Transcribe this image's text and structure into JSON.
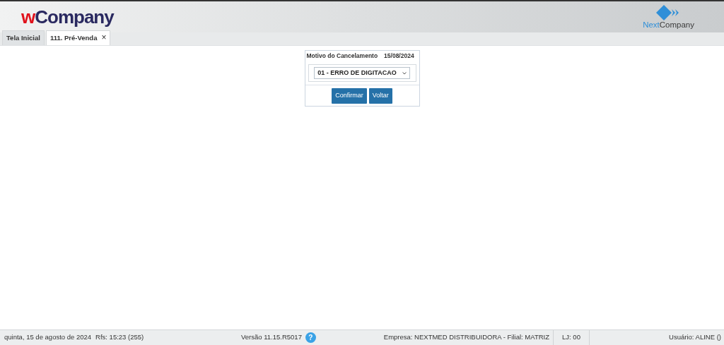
{
  "header": {
    "logo": [
      {
        "text": "w",
        "color": "#e0121c"
      },
      {
        "text": "Company",
        "color": "#2a2960"
      }
    ],
    "brand": [
      {
        "text": "Next",
        "color": "#2f8fd8"
      },
      {
        "text": "Company",
        "color": "#3a3a3a"
      }
    ]
  },
  "tabs": [
    {
      "label": "Tela Inicial",
      "selected": false
    },
    {
      "label": "111. Pré-Venda",
      "selected": true,
      "close": "×"
    }
  ],
  "dialog": {
    "title": "Motivo do Cancelamento",
    "date": "15/08/2024",
    "reason": "01 - ERRO DE DIGITACAO",
    "buttons": [
      "Confirmar",
      "Voltar"
    ]
  },
  "status_bar": {
    "date": "quinta, 15 de agosto de 2024",
    "refresh": "Rfs: 15:23 (255)",
    "version": "Versão 11.15.R5017",
    "help": "?",
    "company": "Empresa: NEXTMED DISTRIBUIDORA - Filial: MATRIZ",
    "store": "LJ: 00",
    "user": "Usuário: ALINE ()"
  }
}
